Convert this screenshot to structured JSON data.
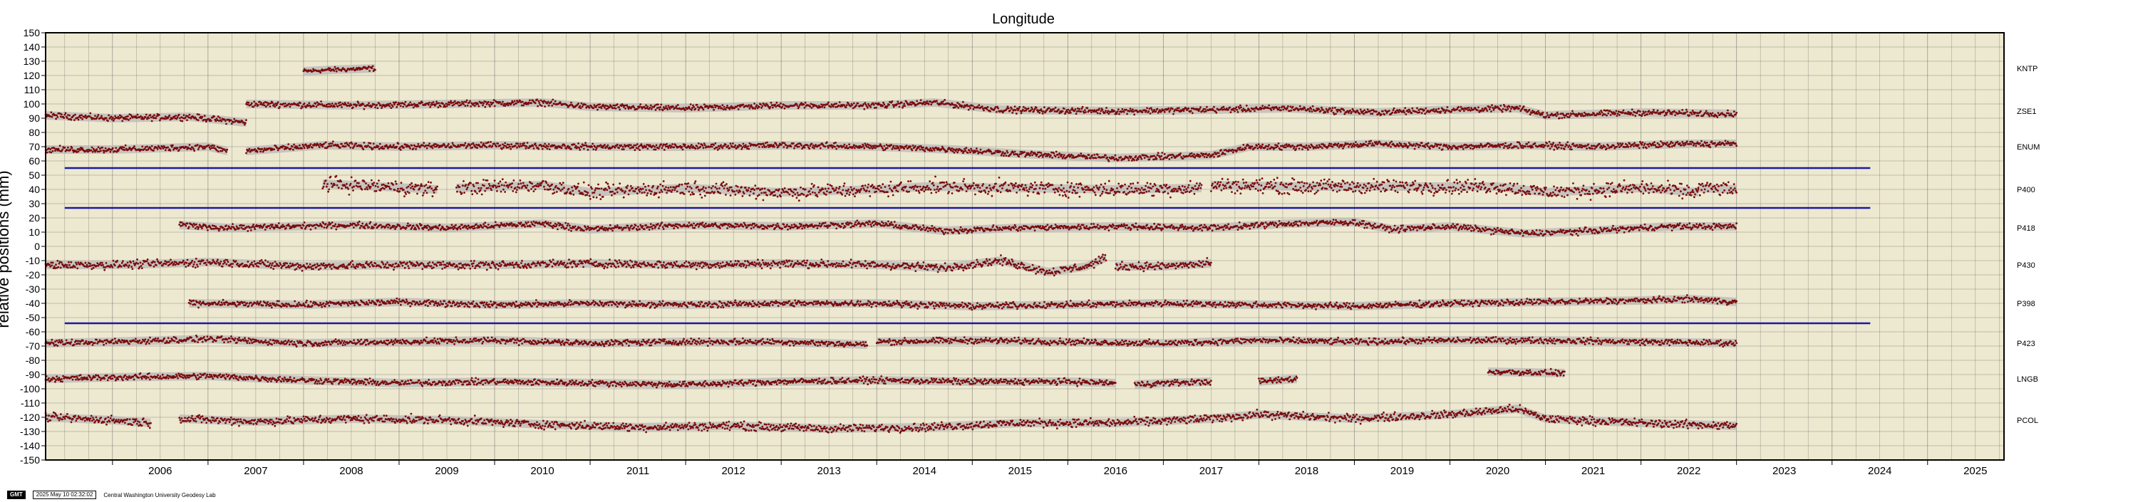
{
  "chart_data": {
    "type": "scatter",
    "title": "Longitude",
    "ylabel": "relative positions (mm)",
    "xlabel": "",
    "xlim": [
      2005.3,
      2025.8
    ],
    "ylim": [
      -150,
      150
    ],
    "xticks": [
      "2006",
      "2007",
      "2008",
      "2009",
      "2010",
      "2011",
      "2012",
      "2013",
      "2014",
      "2015",
      "2016",
      "2017",
      "2018",
      "2019",
      "2020",
      "2021",
      "2022",
      "2023",
      "2024",
      "2025"
    ],
    "yticks": [
      150,
      140,
      130,
      120,
      110,
      100,
      90,
      80,
      70,
      60,
      50,
      40,
      30,
      20,
      10,
      0,
      -10,
      -20,
      -30,
      -40,
      -50,
      -60,
      -70,
      -80,
      -90,
      -100,
      -110,
      -120,
      -130,
      -140,
      -150
    ],
    "grid": true,
    "background_color": "#ede8d0",
    "point_color": "#7a0c0c",
    "band_color": "#b8b8b8",
    "reference_line_color": "#1a1aa0",
    "reference_lines": [
      {
        "y": 55,
        "x_start": 2005.5,
        "x_end": 2024.4
      },
      {
        "y": 27,
        "x_start": 2005.5,
        "x_end": 2024.4
      },
      {
        "y": -54,
        "x_start": 2005.5,
        "x_end": 2024.4
      }
    ],
    "series": [
      {
        "name": "KNTP",
        "offset": 125,
        "scatter": 1.2,
        "segments": [
          {
            "x": [
              2008.0,
              2008.3,
              2008.75
            ],
            "y": [
              123,
              124,
              125
            ]
          }
        ]
      },
      {
        "name": "ZSE1",
        "offset": 95,
        "scatter": 1.5,
        "segments": [
          {
            "x": [
              2005.3,
              2006.0,
              2006.8,
              2007.4
            ],
            "y": [
              92,
              90,
              91,
              87
            ]
          },
          {
            "x": [
              2007.4,
              2008.5,
              2009.5,
              2010.5,
              2011.0,
              2012.0,
              2013.0,
              2014.0,
              2014.6,
              2015.3,
              2016.5,
              2017.5,
              2018.3,
              2019.2,
              2020.0,
              2020.7,
              2021.0,
              2022.0,
              2023.0
            ],
            "y": [
              100,
              99,
              100,
              101,
              98,
              97,
              99,
              99,
              101,
              96,
              95,
              96,
              97,
              94,
              96,
              97,
              92,
              94,
              93
            ]
          }
        ]
      },
      {
        "name": "ENUM",
        "offset": 70,
        "scatter": 1.5,
        "segments": [
          {
            "x": [
              2005.3,
              2006.0,
              2007.0,
              2007.2
            ],
            "y": [
              68,
              68,
              70,
              67
            ]
          },
          {
            "x": [
              2007.4,
              2008.2,
              2009.0,
              2010.0,
              2011.0,
              2012.0,
              2013.0,
              2014.0,
              2014.8,
              2015.5,
              2016.5,
              2017.5,
              2017.9,
              2018.5,
              2019.2,
              2020.0,
              2020.8,
              2021.5,
              2022.5,
              2023.0
            ],
            "y": [
              67,
              71,
              70,
              71,
              70,
              70,
              71,
              70,
              68,
              65,
              62,
              64,
              70,
              70,
              72,
              70,
              71,
              70,
              72,
              72
            ]
          }
        ]
      },
      {
        "name": "P400",
        "offset": 40,
        "scatter": 3.5,
        "segments": [
          {
            "x": [
              2008.2,
              2008.8,
              2009.4
            ],
            "y": [
              44,
              42,
              40
            ]
          },
          {
            "x": [
              2009.6,
              2010.5,
              2011.0,
              2012.0,
              2013.0,
              2014.0,
              2014.5,
              2015.5,
              2016.5,
              2017.4
            ],
            "y": [
              41,
              43,
              38,
              41,
              38,
              40,
              42,
              41,
              40,
              41
            ]
          },
          {
            "x": [
              2017.5,
              2018.5,
              2019.5,
              2020.5,
              2021.0,
              2022.0,
              2022.6
            ],
            "y": [
              43,
              42,
              42,
              42,
              38,
              41,
              38
            ]
          },
          {
            "x": [
              2022.6,
              2023.0
            ],
            "y": [
              41,
              40
            ]
          }
        ]
      },
      {
        "name": "P418",
        "offset": 13,
        "scatter": 1.5,
        "segments": [
          {
            "x": [
              2006.7,
              2007.2
            ],
            "y": [
              15,
              13
            ]
          },
          {
            "x": [
              2007.2,
              2008.5,
              2009.5,
              2010.5,
              2011.0,
              2012.0,
              2013.0,
              2014.0,
              2014.7,
              2015.5,
              2016.5,
              2017.5,
              2018.3,
              2019.0,
              2019.4,
              2020.0,
              2020.8,
              2021.5,
              2022.3,
              2023.0
            ],
            "y": [
              13,
              15,
              13,
              16,
              12,
              15,
              14,
              16,
              11,
              13,
              14,
              13,
              16,
              17,
              12,
              14,
              9,
              11,
              14,
              14
            ]
          }
        ]
      },
      {
        "name": "P430",
        "offset": -13,
        "scatter": 2,
        "segments": [
          {
            "x": [
              2005.3,
              2006.0,
              2006.6,
              2007.0,
              2008.0,
              2009.0,
              2010.0,
              2011.0,
              2012.0,
              2013.0,
              2014.0,
              2014.7,
              2015.3,
              2015.8,
              2016.2,
              2016.4
            ],
            "y": [
              -13,
              -13,
              -12,
              -11,
              -14,
              -13,
              -13,
              -12,
              -13,
              -12,
              -13,
              -15,
              -10,
              -18,
              -14,
              -8
            ]
          },
          {
            "x": [
              2016.5,
              2017.0,
              2017.5
            ],
            "y": [
              -14,
              -14,
              -12
            ]
          }
        ]
      },
      {
        "name": "P398",
        "offset": -40,
        "scatter": 1.5,
        "segments": [
          {
            "x": [
              2006.8,
              2008.0,
              2009.0,
              2010.0,
              2011.0,
              2012.0,
              2013.0,
              2014.0,
              2015.0,
              2016.0,
              2017.0,
              2018.0,
              2019.0,
              2020.0,
              2021.0,
              2022.0,
              2022.5,
              2023.0
            ],
            "y": [
              -40,
              -41,
              -39,
              -41,
              -40,
              -41,
              -40,
              -40,
              -42,
              -41,
              -40,
              -41,
              -42,
              -40,
              -39,
              -38,
              -37,
              -39
            ]
          }
        ]
      },
      {
        "name": "P423",
        "offset": -68,
        "scatter": 1.5,
        "segments": [
          {
            "x": [
              2005.3,
              2006.0,
              2007.0,
              2008.0,
              2009.0,
              2010.0,
              2011.0,
              2012.0,
              2013.0,
              2013.9
            ],
            "y": [
              -68,
              -67,
              -65,
              -68,
              -67,
              -66,
              -68,
              -67,
              -67,
              -69
            ]
          },
          {
            "x": [
              2014.0,
              2015.0,
              2016.0,
              2017.0,
              2018.0,
              2019.0,
              2020.0,
              2021.0,
              2022.0,
              2023.0
            ],
            "y": [
              -67,
              -66,
              -67,
              -68,
              -66,
              -67,
              -66,
              -66,
              -67,
              -68
            ]
          }
        ]
      },
      {
        "name": "LNGB",
        "offset": -93,
        "scatter": 1.5,
        "segments": [
          {
            "x": [
              2005.3,
              2006.0,
              2007.0,
              2008.0,
              2009.0,
              2010.0,
              2011.0,
              2012.0,
              2013.0,
              2014.0,
              2015.0,
              2016.0,
              2016.5
            ],
            "y": [
              -93,
              -92,
              -91,
              -94,
              -96,
              -95,
              -96,
              -97,
              -95,
              -94,
              -95,
              -95,
              -96
            ]
          },
          {
            "x": [
              2016.7,
              2017.0,
              2017.5
            ],
            "y": [
              -97,
              -96,
              -95
            ]
          },
          {
            "x": [
              2018.0,
              2018.4
            ],
            "y": [
              -95,
              -93
            ]
          },
          {
            "x": [
              2020.4,
              2021.2
            ],
            "y": [
              -88,
              -89
            ]
          }
        ]
      },
      {
        "name": "PCOL",
        "offset": -122,
        "scatter": 2,
        "segments": [
          {
            "x": [
              2005.3,
              2006.0,
              2006.4
            ],
            "y": [
              -120,
              -122,
              -124
            ]
          },
          {
            "x": [
              2006.7,
              2007.5,
              2008.5,
              2009.5,
              2010.5,
              2011.5,
              2012.5,
              2013.5,
              2014.5,
              2015.5,
              2016.5,
              2017.5,
              2018.0,
              2019.0,
              2020.0,
              2020.7,
              2021.0,
              2022.0,
              2023.0
            ],
            "y": [
              -121,
              -123,
              -121,
              -122,
              -125,
              -127,
              -126,
              -128,
              -127,
              -124,
              -124,
              -121,
              -118,
              -121,
              -118,
              -114,
              -121,
              -124,
              -126
            ]
          }
        ]
      }
    ]
  },
  "footer": {
    "gmt_logo_text": "GMT",
    "timestamp": "2025 May 10 02:32:02",
    "credit": "Central Washington University Geodesy Lab"
  }
}
